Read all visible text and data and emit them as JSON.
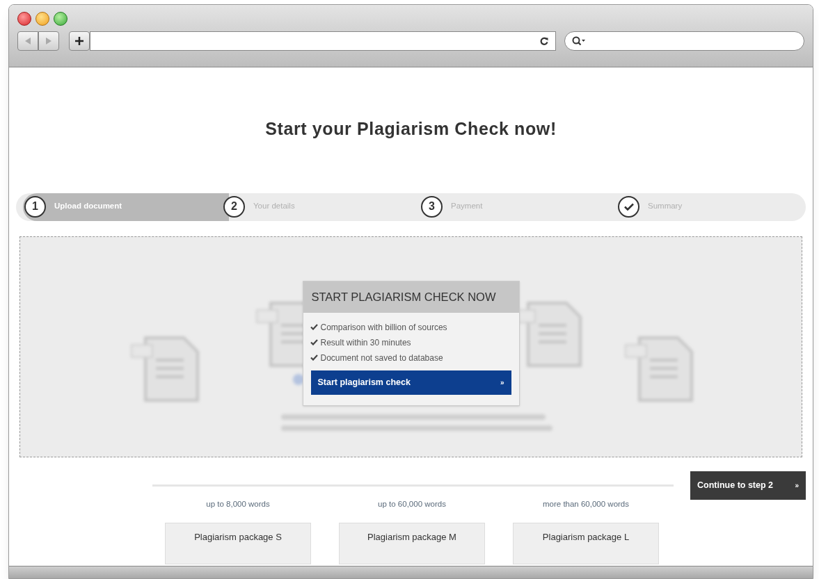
{
  "heading": "Start your Plagiarism Check now!",
  "steps": [
    {
      "kind": "number",
      "number": "1",
      "label": "Upload document",
      "selected": true
    },
    {
      "kind": "number",
      "number": "2",
      "label": "Your details",
      "selected": false
    },
    {
      "kind": "number",
      "number": "3",
      "label": "Payment",
      "selected": false
    },
    {
      "kind": "check",
      "label": "Summary",
      "selected": false
    }
  ],
  "popup": {
    "title": "START PLAGIARISM CHECK NOW",
    "features": [
      "Comparison with billion of sources",
      "Result within 30 minutes",
      "Document not saved to database"
    ],
    "button": "Start plagiarism check",
    "button_arrow": "»"
  },
  "continue_button": {
    "label": "Continue to step 2",
    "arrow": "»"
  },
  "packages": [
    {
      "words": "up to 8,000 words",
      "name": "Plagiarism package S"
    },
    {
      "words": "up to 60,000 words",
      "name": "Plagiarism package M"
    },
    {
      "words": "more than 60,000 words",
      "name": "Plagiarism package L"
    }
  ]
}
